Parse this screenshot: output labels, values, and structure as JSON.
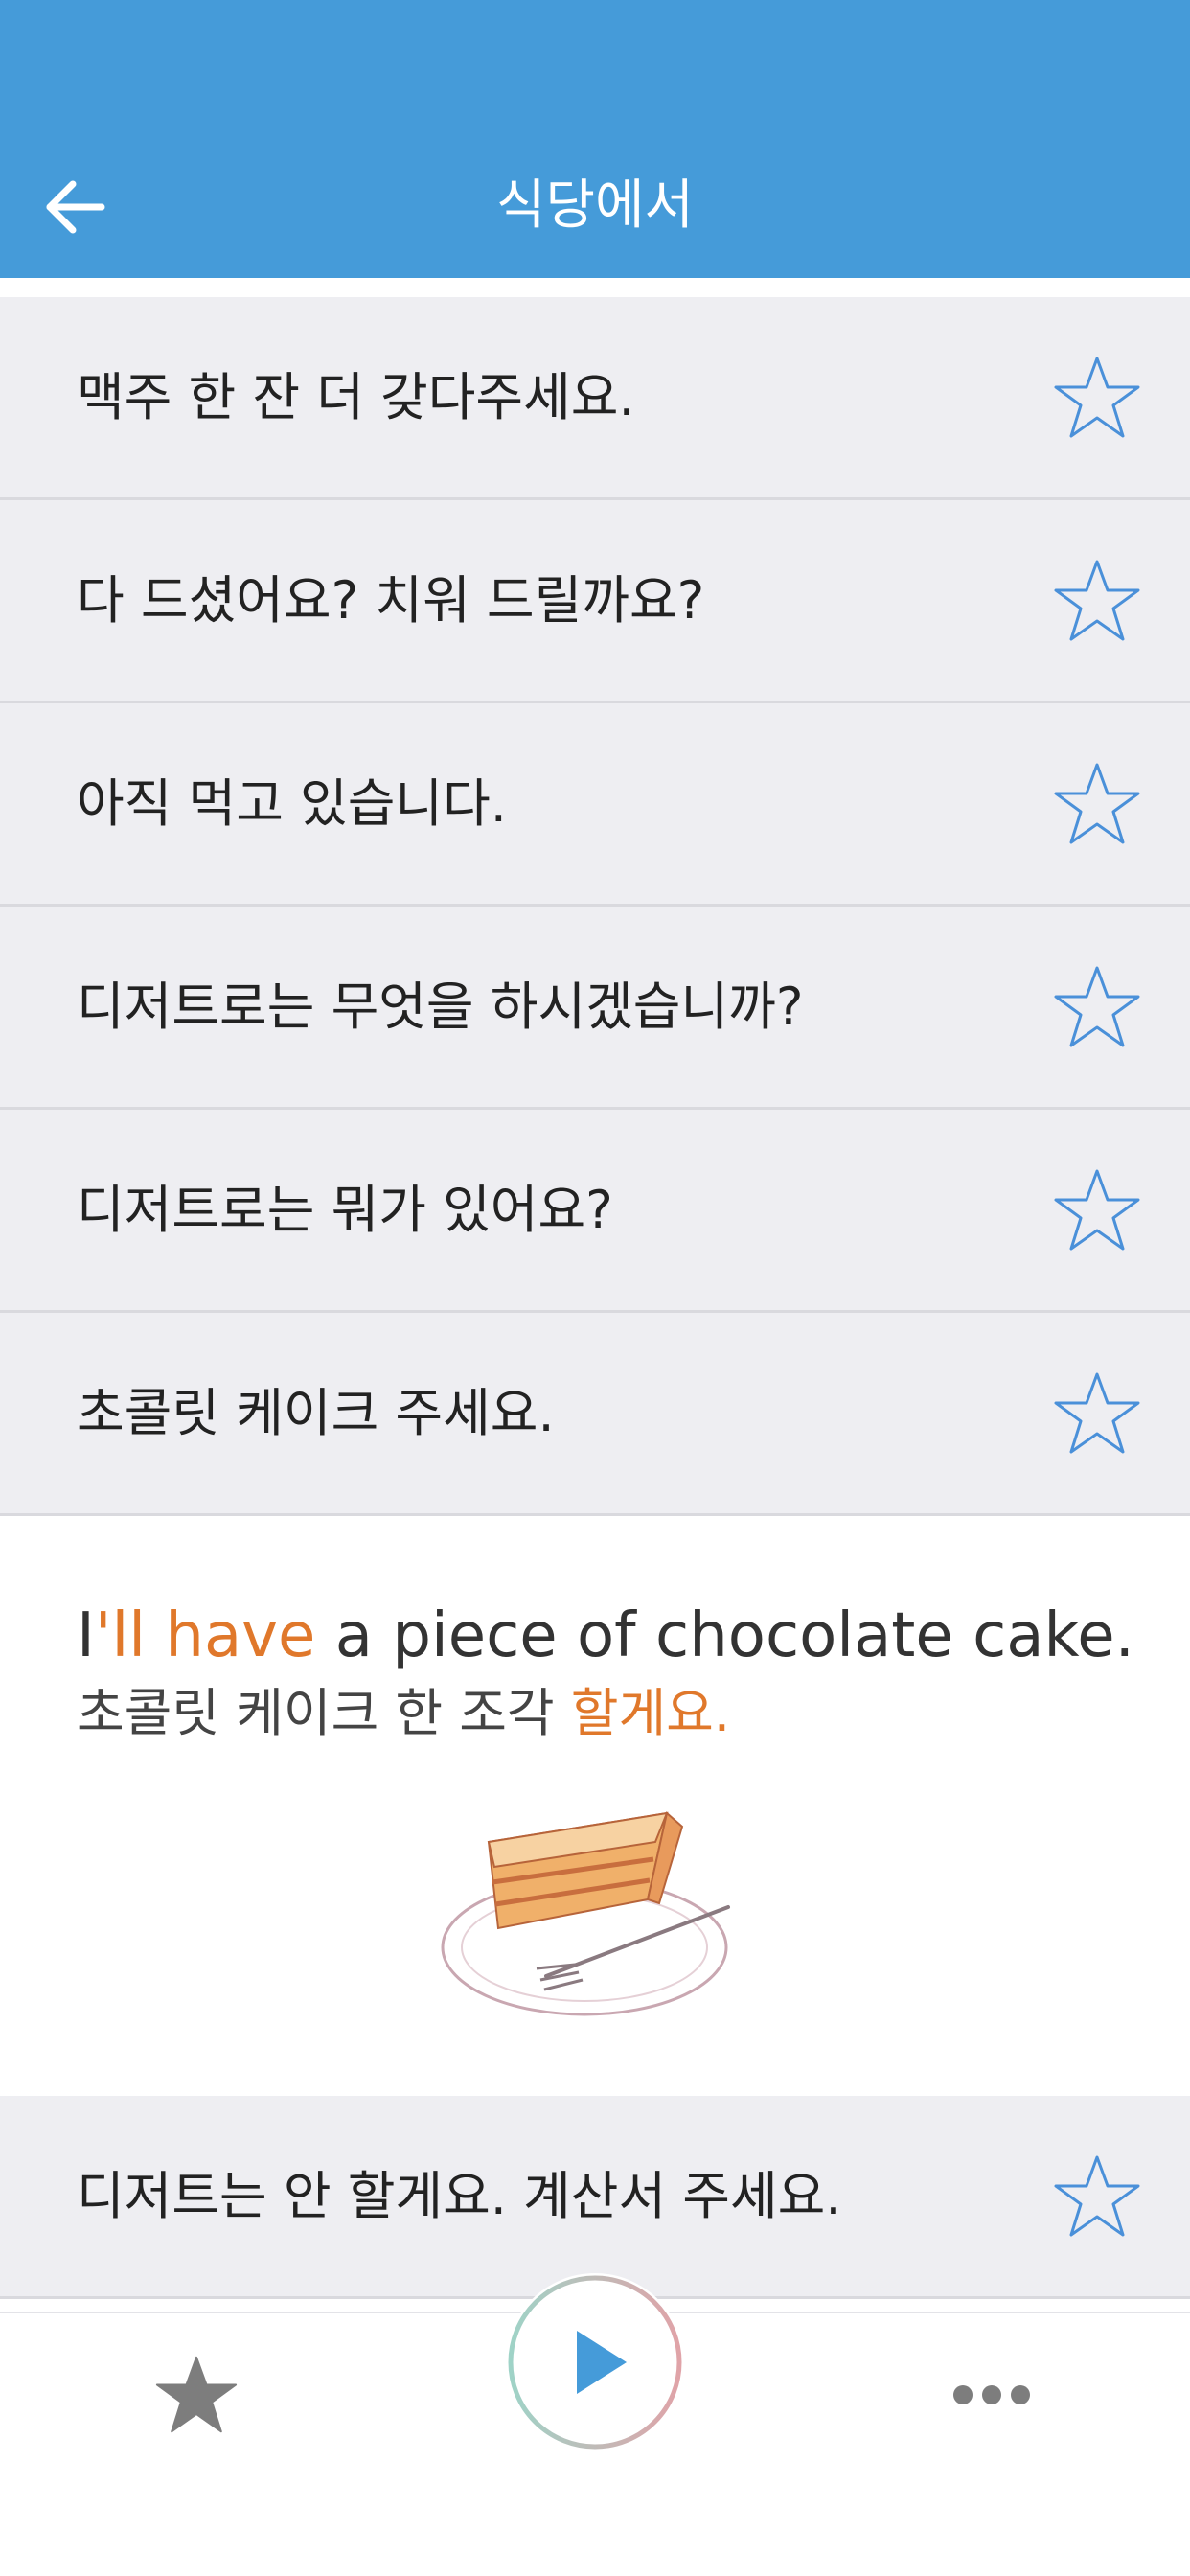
{
  "header": {
    "title": "식당에서",
    "bg_color": "#459bd9"
  },
  "phrases": [
    {
      "text": "맥주 한 잔 더 갖다주세요.",
      "starred": false
    },
    {
      "text": "다 드셨어요? 치워 드릴까요?",
      "starred": false
    },
    {
      "text": "아직 먹고 있습니다.",
      "starred": false
    },
    {
      "text": "디저트로는 무엇을 하시겠습니까?",
      "starred": false
    },
    {
      "text": "디저트로는 뭐가 있어요?",
      "starred": false
    },
    {
      "text": "초콜릿 케이크 주세요.",
      "starred": false
    }
  ],
  "expanded": {
    "en_prefix": "I",
    "en_highlight": "'ll have",
    "en_rest": " a piece of chocolate cake.",
    "ko_prefix": "초콜릿 케이크 한 조각 ",
    "ko_highlight": "할게요.",
    "image": "chocolate-cake-slice",
    "highlight_color": "#e0782b"
  },
  "last_phrase": {
    "text": "디저트는 안 할게요. 계산서 주세요.",
    "starred": false
  },
  "bottom_bar": {
    "favorites_icon": "star-filled-icon",
    "play_icon": "play-icon",
    "more_icon": "more-dots-icon"
  },
  "colors": {
    "star_outline": "#4a90d9",
    "row_bg": "#eeeef2"
  }
}
